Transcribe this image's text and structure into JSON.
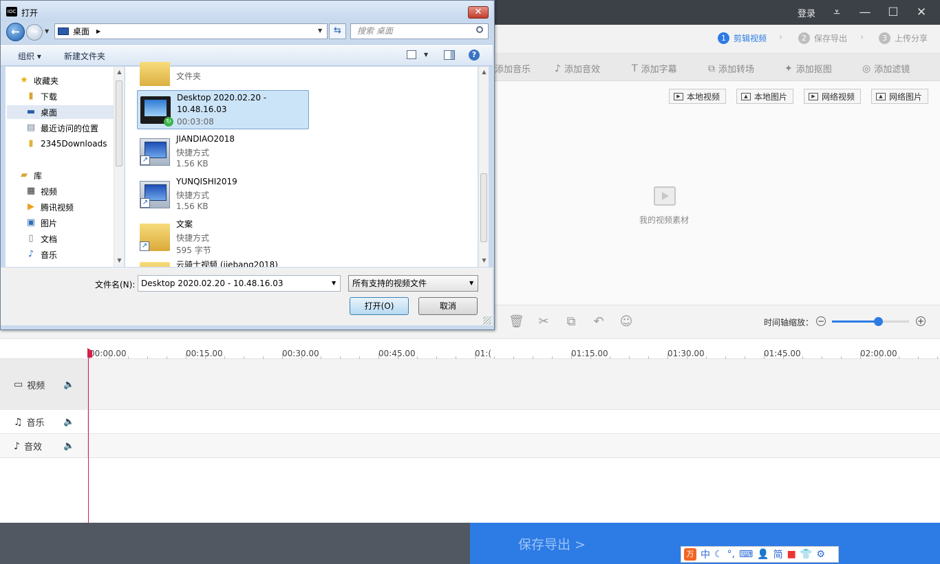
{
  "app": {
    "login": "登录",
    "steps": [
      {
        "num": "1",
        "label": "剪辑视频"
      },
      {
        "num": "2",
        "label": "保存导出"
      },
      {
        "num": "3",
        "label": "上传分享"
      }
    ],
    "tools": [
      "添加音乐",
      "添加音效",
      "添加字幕",
      "添加转场",
      "添加抠图",
      "添加滤镜"
    ],
    "source_buttons": [
      "本地视频",
      "本地图片",
      "网络视频",
      "网络图片"
    ],
    "empty_text": "我的视频素材",
    "zoom_label": "时间轴缩放：",
    "zoom_level": 0.6,
    "ruler_ticks": [
      "00:00.00",
      "00:15.00",
      "00:30.00",
      "00:45.00",
      "01:(",
      "01:15.00",
      "01:30.00",
      "01:45.00",
      "02:00.00"
    ],
    "tracks": [
      {
        "label": "视频"
      },
      {
        "label": "音乐"
      },
      {
        "label": "音效"
      }
    ],
    "save_export": "保存导出 >",
    "ime": {
      "items": [
        "中",
        "简"
      ]
    },
    "accent": "#2d7be5"
  },
  "dialog": {
    "title": "打开",
    "address": "桌面",
    "search_placeholder": "搜索 桌面",
    "cmd_organize": "组织 ▾",
    "cmd_new_folder": "新建文件夹",
    "nav": [
      {
        "label": "收藏夹",
        "sub": false
      },
      {
        "label": "下载",
        "sub": true
      },
      {
        "label": "桌面",
        "sub": true
      },
      {
        "label": "最近访问的位置",
        "sub": true
      },
      {
        "label": "2345Downloads",
        "sub": true
      },
      {
        "label": "库",
        "sub": false
      },
      {
        "label": "视频",
        "sub": true
      },
      {
        "label": "腾讯视频",
        "sub": true
      },
      {
        "label": "图片",
        "sub": true
      },
      {
        "label": "文档",
        "sub": true
      },
      {
        "label": "音乐",
        "sub": true
      }
    ],
    "files": [
      {
        "name": "",
        "meta1": "文件夹"
      },
      {
        "name": "Desktop 2020.02.20 - 10.48.16.03",
        "meta1": "00:03:08"
      },
      {
        "name": "JIANDIAO2018",
        "meta1": "快捷方式",
        "meta2": "1.56 KB"
      },
      {
        "name": "YUNQISHI2019",
        "meta1": "快捷方式",
        "meta2": "1.56 KB"
      },
      {
        "name": "文案",
        "meta1": "快捷方式",
        "meta2": "595 字节"
      },
      {
        "name": "云骑士视频 (jiebang2018)"
      }
    ],
    "filename_label": "文件名(N):",
    "filename_value": "Desktop 2020.02.20 - 10.48.16.03",
    "filetype": "所有支持的视频文件",
    "open_button": "打开(O)",
    "cancel_button": "取消"
  }
}
